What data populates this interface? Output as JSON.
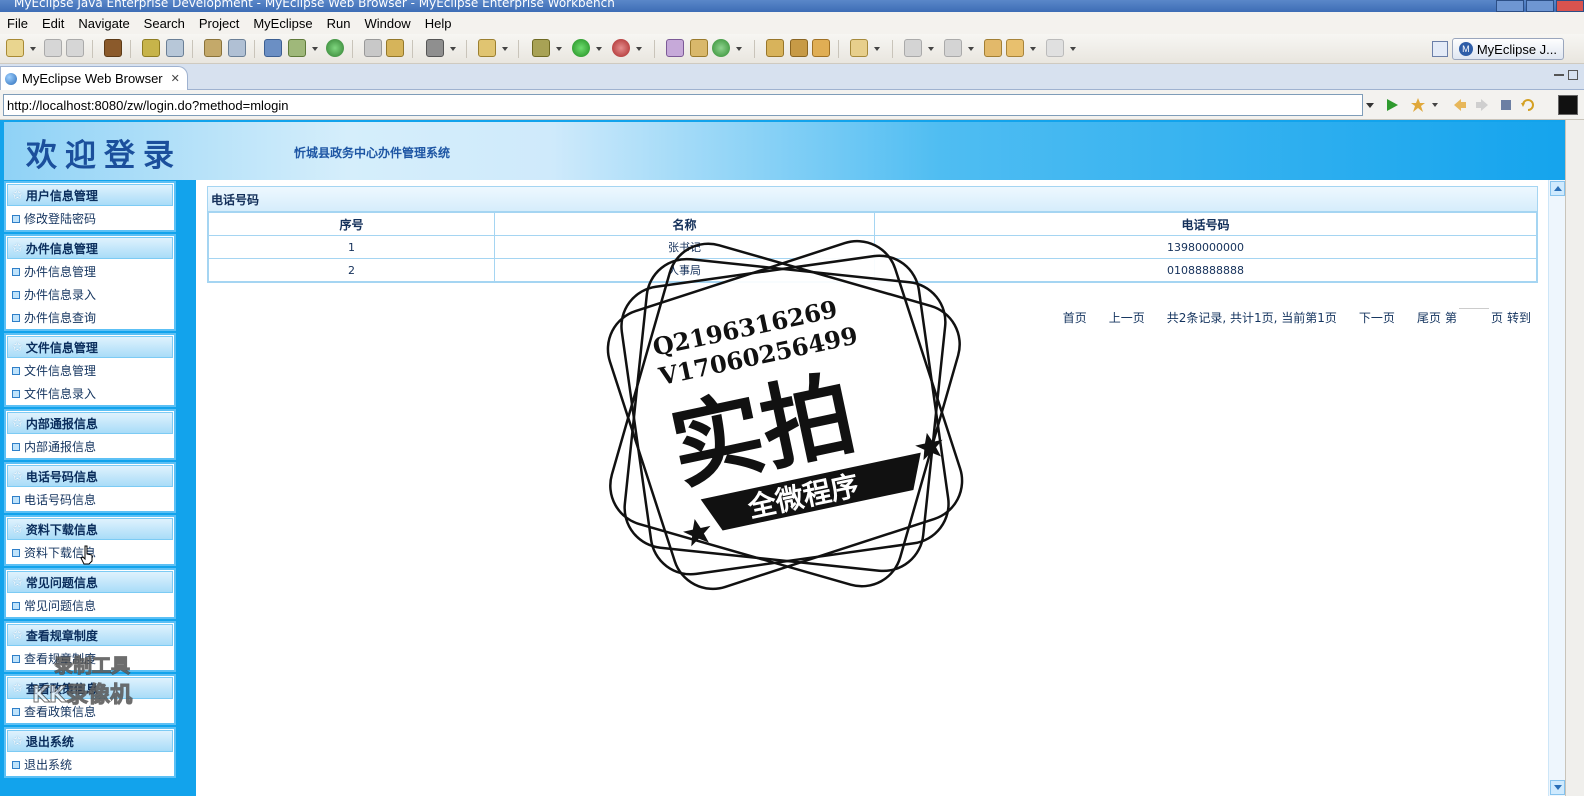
{
  "window": {
    "title": "MyEclipse Java Enterprise Development - MyEclipse Web Browser - MyEclipse Enterprise Workbench"
  },
  "menu": [
    "File",
    "Edit",
    "Navigate",
    "Search",
    "Project",
    "MyEclipse",
    "Run",
    "Window",
    "Help"
  ],
  "perspective": {
    "label": "MyEclipse J...",
    "icon": "myeclipse-m-icon"
  },
  "editor_tab": {
    "label": "MyEclipse Web Browser",
    "icon": "globe-icon"
  },
  "address": {
    "url": "http://localhost:8080/zw/login.do?method=mlogin"
  },
  "page": {
    "welcome": "欢迎登录",
    "system_name": "忻城县政务中心办件管理系统",
    "sidebar": [
      {
        "title": "用户信息管理",
        "items": [
          "修改登陆密码"
        ]
      },
      {
        "title": "办件信息管理",
        "items": [
          "办件信息管理",
          "办件信息录入",
          "办件信息查询"
        ]
      },
      {
        "title": "文件信息管理",
        "items": [
          "文件信息管理",
          "文件信息录入"
        ]
      },
      {
        "title": "内部通报信息",
        "items": [
          "内部通报信息"
        ]
      },
      {
        "title": "电话号码信息",
        "items": [
          "电话号码信息"
        ]
      },
      {
        "title": "资料下载信息",
        "items": [
          "资料下载信息"
        ]
      },
      {
        "title": "常见问题信息",
        "items": [
          "常见问题信息"
        ]
      },
      {
        "title": "查看规章制度",
        "items": [
          "查看规章制度"
        ]
      },
      {
        "title": "查看政策信息",
        "items": [
          "查看政策信息"
        ]
      },
      {
        "title": "退出系统",
        "items": [
          "退出系统"
        ]
      }
    ],
    "panel_title": "电话号码",
    "table": {
      "columns": [
        "序号",
        "名称",
        "电话号码"
      ],
      "rows": [
        [
          "1",
          "张书记",
          "13980000000"
        ],
        [
          "2",
          "人事局",
          "01088888888"
        ]
      ]
    },
    "pager": {
      "first": "首页",
      "prev": "上一页",
      "summary": "共2条记录, 共计1页, 当前第1页",
      "next": "下一页",
      "last": "尾页",
      "page_prefix": "第",
      "page_suffix": "页",
      "go": "转到"
    }
  },
  "watermark": {
    "line1": "Q2196316269",
    "line2": "V17060256499",
    "big": "实拍",
    "ribbon": "全微程序",
    "recorder_line1": "录制工具",
    "recorder_line2": "KK录像机"
  },
  "colors": {
    "page_bg": "#12a3ec",
    "banner_text": "#1b4f9c",
    "panel_border": "#a5d5f2"
  }
}
